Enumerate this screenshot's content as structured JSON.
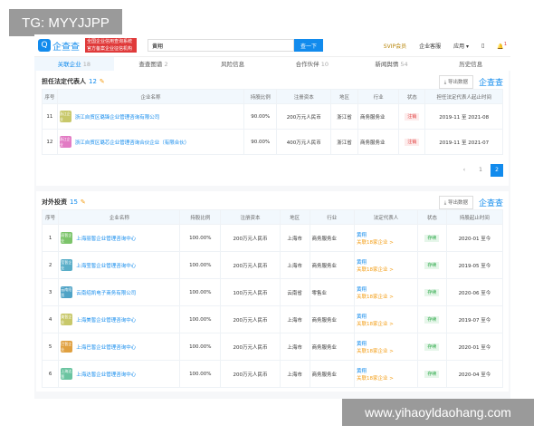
{
  "watermarks": {
    "top": "TG: MYYJJPP",
    "bottom": "www.yihaoyldaohang.com"
  },
  "header": {
    "logo": "企查查",
    "logo_sub": "Qcc.com",
    "badge": "全国企业信用查询系统 官方备案企业征信机构",
    "search_value": "黄翔",
    "search_button": "查一下",
    "vip": "SVIP会员",
    "service": "企业客服",
    "apps": "应用 ▾",
    "notif_count": "1"
  },
  "tabs": [
    {
      "label": "关联企业",
      "count": "18",
      "active": true
    },
    {
      "label": "查查图谱",
      "count": "2"
    },
    {
      "label": "风险信息",
      "count": ""
    },
    {
      "label": "合作伙伴",
      "count": "10"
    },
    {
      "label": "新闻舆情",
      "count": "54"
    },
    {
      "label": "历史信息",
      "count": ""
    }
  ],
  "colors": {
    "accent": "#128bed",
    "cancelled": "#e03a3a",
    "active": "#28a745"
  },
  "legal_rep": {
    "title": "担任法定代表人",
    "count": "12",
    "export": "导出数据",
    "brand": "企查查",
    "columns": [
      "序号",
      "企业名称",
      "持股比例",
      "注册资本",
      "地区",
      "行业",
      "状态",
      "担任法定代表人起止时间"
    ],
    "rows": [
      {
        "no": "11",
        "logo": "浙江企业",
        "logo_color": "#c8c86a",
        "name": "浙江自贸区璐锋企业管理咨询有限公司",
        "share": "90.00%",
        "capital": "200万元人民币",
        "region": "浙江省",
        "industry": "商务服务业",
        "status": "注销",
        "period": "2019-11 至 2021-08"
      },
      {
        "no": "12",
        "logo": "浙江企业",
        "logo_color": "#e27bc4",
        "name": "浙江自贸区璐芯企业管理咨询合伙企业（有限合伙）",
        "share": "90.00%",
        "capital": "400万元人民币",
        "region": "浙江省",
        "industry": "商务服务业",
        "status": "注销",
        "period": "2019-11 至 2021-07"
      }
    ],
    "pages": [
      "‹",
      "1",
      "2"
    ],
    "current_page": "2"
  },
  "investments": {
    "title": "对外投资",
    "count": "15",
    "export": "导出数据",
    "brand": "企查查",
    "columns": [
      "序号",
      "企业名称",
      "持股比例",
      "注册资本",
      "地区",
      "行业",
      "法定代表人",
      "状态",
      "持股起止时间"
    ],
    "rows": [
      {
        "no": "1",
        "logo": "丽皙企业",
        "logo_color": "#7cc46a",
        "name": "上海丽皙企业管理咨询中心",
        "share": "100.00%",
        "capital": "200万元人民币",
        "region": "上海市",
        "industry": "商务服务业",
        "rep": "黄翔",
        "rel": "关联18家企业 >",
        "status": "存续",
        "period": "2020-01 至今"
      },
      {
        "no": "2",
        "logo": "莹皙企业",
        "logo_color": "#5aaec8",
        "name": "上海莹皙企业管理咨询中心",
        "share": "100.00%",
        "capital": "200万元人民币",
        "region": "上海市",
        "industry": "商务服务业",
        "rep": "黄翔",
        "rel": "关联18家企业 >",
        "status": "存续",
        "period": "2019-05 至今"
      },
      {
        "no": "3",
        "logo": "云南绍凯",
        "logo_color": "#4fa3c6",
        "name": "云南绍凯电子商务有限公司",
        "share": "100.00%",
        "capital": "100万元人民币",
        "region": "云南省",
        "industry": "零售业",
        "rep": "黄翔",
        "rel": "关联18家企业 >",
        "status": "存续",
        "period": "2020-06 至今"
      },
      {
        "no": "4",
        "logo": "美皙企业",
        "logo_color": "#c8c86a",
        "name": "上海美皙企业管理咨询中心",
        "share": "100.00%",
        "capital": "200万元人民币",
        "region": "上海市",
        "industry": "商务服务业",
        "rep": "黄翔",
        "rel": "关联18家企业 >",
        "status": "存续",
        "period": "2019-07 至今"
      },
      {
        "no": "5",
        "logo": "巴皙企业",
        "logo_color": "#e0a040",
        "name": "上海巴皙企业管理咨询中心",
        "share": "100.00%",
        "capital": "200万元人民币",
        "region": "上海市",
        "industry": "商务服务业",
        "rep": "黄翔",
        "rel": "关联18家企业 >",
        "status": "存续",
        "period": "2020-01 至今"
      },
      {
        "no": "6",
        "logo": "上海达皙",
        "logo_color": "#6ac4a0",
        "name": "上海达皙企业管理咨询中心",
        "share": "100.00%",
        "capital": "200万元人民币",
        "region": "上海市",
        "industry": "商务服务业",
        "rep": "黄翔",
        "rel": "关联18家企业 >",
        "status": "存续",
        "period": "2020-04 至今"
      }
    ]
  }
}
